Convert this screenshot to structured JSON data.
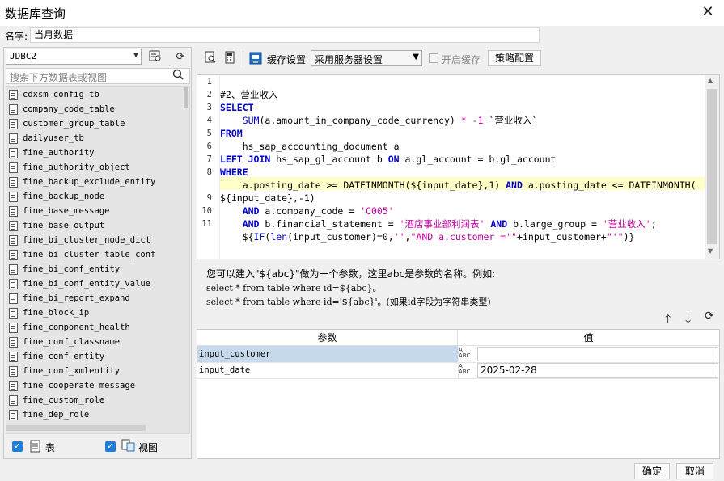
{
  "window": {
    "title": "数据库查询"
  },
  "name": {
    "label": "名字:",
    "value": "当月数据"
  },
  "left": {
    "db_select": "JDBC2",
    "search_placeholder": "搜索下方数据表或视图",
    "tables": [
      "cdxsm_config_tb",
      "company_code_table",
      "customer_group_table",
      "dailyuser_tb",
      "fine_authority",
      "fine_authority_object",
      "fine_backup_exclude_entity",
      "fine_backup_node",
      "fine_base_message",
      "fine_base_output",
      "fine_bi_cluster_node_dict",
      "fine_bi_cluster_table_conf",
      "fine_bi_conf_entity",
      "fine_bi_conf_entity_value",
      "fine_bi_report_expand",
      "fine_block_ip",
      "fine_component_health",
      "fine_conf_classname",
      "fine_conf_entity",
      "fine_conf_xmlentity",
      "fine_cooperate_message",
      "fine_custom_role",
      "fine_dep_role"
    ],
    "check_table_label": "表",
    "check_view_label": "视图"
  },
  "toolbar": {
    "cache_settings_label": "缓存设置",
    "cache_mode_select": "采用服务器设置",
    "enable_cache_label": "开启缓存",
    "strategy_button": "策略配置"
  },
  "editor": {
    "line_numbers": [
      "1",
      "2",
      "3",
      "4",
      "5",
      "6",
      "7",
      "8",
      "",
      "9",
      "10",
      "11"
    ]
  },
  "hint": {
    "line1": "您可以建入\"${abc}\"做为一个参数，这里abc是参数的名称。例如:",
    "line2": "select * from table where id=${abc}。",
    "line3": "select * from table where id='${abc}'。(如果id字段为字符串类型)"
  },
  "params": {
    "col_param": "参数",
    "col_value": "值",
    "rows": [
      {
        "name": "input_customer",
        "type": "ABC",
        "value": ""
      },
      {
        "name": "input_date",
        "type": "ABC",
        "value": "2025-02-28"
      }
    ]
  },
  "footer": {
    "ok": "确定",
    "cancel": "取消"
  },
  "colors": {
    "keyword": "#0000cc",
    "string": "#c000a0",
    "highlight": "#ffffc8",
    "checkbox": "#1e7fd8"
  }
}
